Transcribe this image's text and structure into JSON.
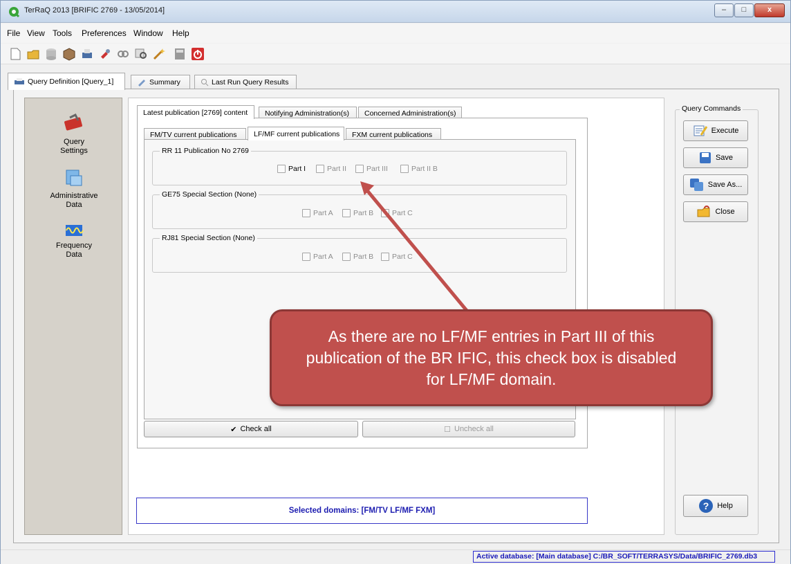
{
  "window": {
    "title": "TerRaQ 2013 [BRIFIC 2769 - 13/05/2014]",
    "minimize": "–",
    "maximize": "□",
    "close": "x"
  },
  "menu": [
    "File",
    "View",
    "Tools",
    "Preferences",
    "Window",
    "Help"
  ],
  "toolbar_icons": [
    "new-file-icon",
    "open-folder-icon",
    "database-icon",
    "package-icon",
    "print-icon",
    "tools-icon",
    "links-icon",
    "search-icon",
    "wand-icon",
    "calculator-icon",
    "power-icon"
  ],
  "main_tabs": [
    {
      "label": "Query Definition [Query_1]",
      "active": true
    },
    {
      "label": "Summary",
      "active": false
    },
    {
      "label": "Last Run Query Results",
      "active": false
    }
  ],
  "sidebar": {
    "items": [
      {
        "label": "Query Settings",
        "icon": "toolbox-icon"
      },
      {
        "label": "Administrative Data",
        "icon": "admin-data-icon"
      },
      {
        "label": "Frequency Data",
        "icon": "frequency-icon"
      }
    ]
  },
  "content_tabs": [
    {
      "label": "Latest publication [2769] content",
      "active": true
    },
    {
      "label": "Notifying Administration(s)",
      "active": false
    },
    {
      "label": "Concerned Administration(s)",
      "active": false
    }
  ],
  "sub_tabs": [
    {
      "label": "FM/TV current publications",
      "active": false
    },
    {
      "label": "LF/MF current publications",
      "active": true
    },
    {
      "label": "FXM current publications",
      "active": false
    }
  ],
  "groups": [
    {
      "title": "RR 11 Publication No 2769",
      "checkboxes": [
        "Part I",
        "Part II",
        "Part III",
        "Part II B"
      ]
    },
    {
      "title": "GE75 Special Section (None)",
      "checkboxes": [
        "Part A",
        "Part B",
        "Part C"
      ]
    },
    {
      "title": "RJ81 Special Section (None)",
      "checkboxes": [
        "Part A",
        "Part B",
        "Part C"
      ]
    }
  ],
  "check_all": "Check all",
  "uncheck_all": "Uncheck all",
  "selected_domains": "Selected domains: [FM/TV  LF/MF  FXM]",
  "commands": {
    "title": "Query Commands",
    "execute": "Execute",
    "save": "Save",
    "save_as": "Save As...",
    "close": "Close",
    "help": "Help"
  },
  "callout": "As there are no LF/MF entries in Part III of this publication of the BR IFIC, this check box is disabled for LF/MF domain.",
  "status": {
    "active_db": "Active database: [Main database] C:/BR_SOFT/TERRASYS/Data/BRIFIC_2769.db3"
  },
  "colors": {
    "callout": "#c0504d",
    "arrow": "#c0504d",
    "selected_text": "#1c1cb0"
  }
}
